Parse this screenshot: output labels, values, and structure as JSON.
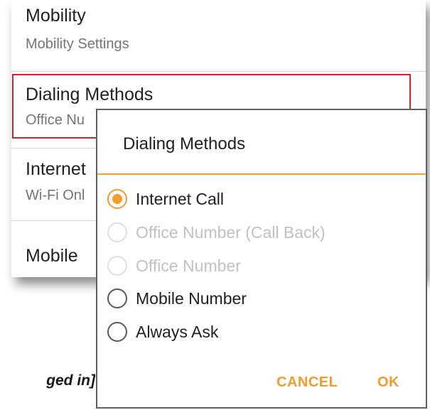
{
  "settings": {
    "items": [
      {
        "title": "Mobility",
        "summary": "Mobility Settings"
      },
      {
        "title": "Dialing Methods",
        "summary": "Office Nu"
      },
      {
        "title": "Internet",
        "summary": "Wi-Fi Onl"
      },
      {
        "title": "Mobile "
      }
    ]
  },
  "caption": "ged in]",
  "dialog": {
    "title": "Dialing Methods",
    "options": [
      {
        "label": "Internet Call",
        "state": "checked"
      },
      {
        "label": "Office Number (Call Back)",
        "state": "disabled"
      },
      {
        "label": "Office Number",
        "state": "disabled"
      },
      {
        "label": "Mobile Number",
        "state": "unchecked"
      },
      {
        "label": "Always Ask",
        "state": "unchecked"
      }
    ],
    "cancel_label": "CANCEL",
    "ok_label": "OK"
  },
  "colors": {
    "accent": "#f39c2f",
    "highlight": "#d9212b",
    "divider_accent": "#f0a239"
  }
}
